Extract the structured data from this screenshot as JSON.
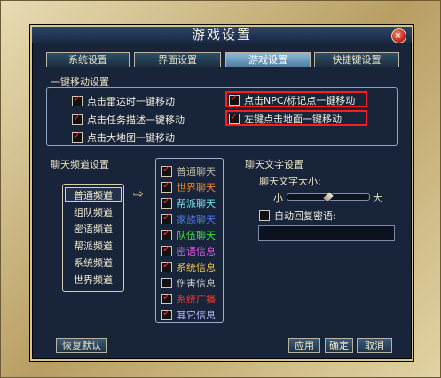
{
  "window": {
    "title": "游戏设置",
    "close_label": "×"
  },
  "tabs": [
    {
      "label": "系统设置",
      "active": false
    },
    {
      "label": "界面设置",
      "active": false
    },
    {
      "label": "游戏设置",
      "active": true
    },
    {
      "label": "快捷键设置",
      "active": false
    }
  ],
  "move_section": {
    "title": "一键移动设置",
    "options": [
      {
        "label": "点击雷达时一键移动",
        "checked": true
      },
      {
        "label": "点击任务描述一键移动",
        "checked": true
      },
      {
        "label": "点击大地图一键移动",
        "checked": true
      },
      {
        "label": "点击NPC/标记点一键移动",
        "checked": true
      },
      {
        "label": "左键点击地面一键移动",
        "checked": true
      }
    ]
  },
  "chat_channel": {
    "title": "聊天频道设置",
    "channels": [
      {
        "label": "普通频道",
        "selected": true
      },
      {
        "label": "组队频道",
        "selected": false
      },
      {
        "label": "密语频道",
        "selected": false
      },
      {
        "label": "帮派频道",
        "selected": false
      },
      {
        "label": "系统频道",
        "selected": false
      },
      {
        "label": "世界频道",
        "selected": false
      }
    ],
    "arrow": "⇨",
    "messages": [
      {
        "label": "普通聊天",
        "checked": true,
        "color": "#bdb8a3"
      },
      {
        "label": "世界聊天",
        "checked": true,
        "color": "#e98532"
      },
      {
        "label": "帮派聊天",
        "checked": true,
        "color": "#7fe0ee"
      },
      {
        "label": "家族聊天",
        "checked": true,
        "color": "#4d7be0"
      },
      {
        "label": "队伍聊天",
        "checked": true,
        "color": "#40e03a"
      },
      {
        "label": "密语信息",
        "checked": true,
        "color": "#d55bde"
      },
      {
        "label": "系统信息",
        "checked": true,
        "color": "#e8c64d"
      },
      {
        "label": "伤害信息",
        "checked": false,
        "color": "#cfcfcf"
      },
      {
        "label": "系统广播",
        "checked": true,
        "color": "#e83a35"
      },
      {
        "label": "其它信息",
        "checked": true,
        "color": "#bcbcff"
      }
    ]
  },
  "chat_text": {
    "title": "聊天文字设置",
    "size_label": "聊天文字大小:",
    "small_label": "小",
    "large_label": "大",
    "size_value": 0.5,
    "auto_reply_label": "自动回复密语:",
    "auto_reply_checked": false,
    "auto_reply_value": ""
  },
  "buttons": {
    "restore": "恢复默认",
    "apply": "应用",
    "ok": "确定",
    "cancel": "取消"
  }
}
